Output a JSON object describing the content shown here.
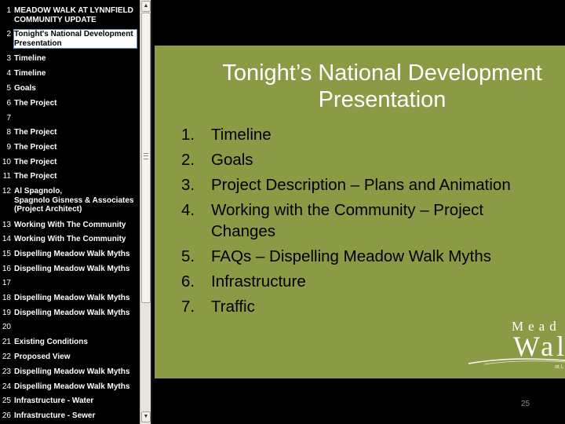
{
  "outline": {
    "items": [
      {
        "num": "1",
        "title": "MEADOW WALK AT LYNNFIELD\nCOMMUNITY UPDATE"
      },
      {
        "num": "2",
        "title": "Tonight's National Development\nPresentation",
        "selected": true
      },
      {
        "num": "3",
        "title": "Timeline"
      },
      {
        "num": "4",
        "title": "Timeline"
      },
      {
        "num": "5",
        "title": "Goals"
      },
      {
        "num": "6",
        "title": "The Project"
      },
      {
        "num": "7",
        "title": ""
      },
      {
        "num": "8",
        "title": "The Project"
      },
      {
        "num": "9",
        "title": "The Project"
      },
      {
        "num": "10",
        "title": "The Project"
      },
      {
        "num": "11",
        "title": "The Project"
      },
      {
        "num": "12",
        "title": "Al Spagnolo,\nSpagnolo Gisness & Associates\n(Project Architect)"
      },
      {
        "num": "13",
        "title": "Working With The Community"
      },
      {
        "num": "14",
        "title": "Working With The Community"
      },
      {
        "num": "15",
        "title": "Dispelling Meadow Walk Myths"
      },
      {
        "num": "16",
        "title": "Dispelling Meadow Walk Myths"
      },
      {
        "num": "17",
        "title": ""
      },
      {
        "num": "18",
        "title": "Dispelling Meadow Walk Myths"
      },
      {
        "num": "19",
        "title": "Dispelling Meadow Walk Myths"
      },
      {
        "num": "20",
        "title": ""
      },
      {
        "num": "21",
        "title": "Existing Conditions"
      },
      {
        "num": "22",
        "title": "Proposed View"
      },
      {
        "num": "23",
        "title": "Dispelling Meadow Walk Myths"
      },
      {
        "num": "24",
        "title": "Dispelling Meadow Walk Myths"
      },
      {
        "num": "25",
        "title": "Infrastructure - Water"
      },
      {
        "num": "26",
        "title": "Infrastructure - Sewer"
      }
    ]
  },
  "scrollbar": {
    "up_icon": "arrow-up-icon",
    "down_icon": "arrow-down-icon",
    "grip_icon": "grip-icon"
  },
  "slide": {
    "title": "Tonight’s National Development Presentation",
    "agenda": [
      {
        "num": "1.",
        "text": "Timeline"
      },
      {
        "num": "2.",
        "text": "Goals"
      },
      {
        "num": "3.",
        "text": "Project Description – Plans and Animation"
      },
      {
        "num": "4.",
        "text": "Working with the Community – Project\nChanges"
      },
      {
        "num": "5.",
        "text": "FAQs – Dispelling Meadow Walk Myths"
      },
      {
        "num": "6.",
        "text": "Infrastructure"
      },
      {
        "num": "7.",
        "text": "Traffic"
      }
    ],
    "background_color": "#8b9a45",
    "logo": {
      "line1": "Mead",
      "line2": "Wal",
      "line3": "at L"
    }
  },
  "page_number": "25",
  "colors": {
    "sidebar_background": "#000000",
    "slide_background": "#8b9a45",
    "selection_background": "#ffffff"
  }
}
